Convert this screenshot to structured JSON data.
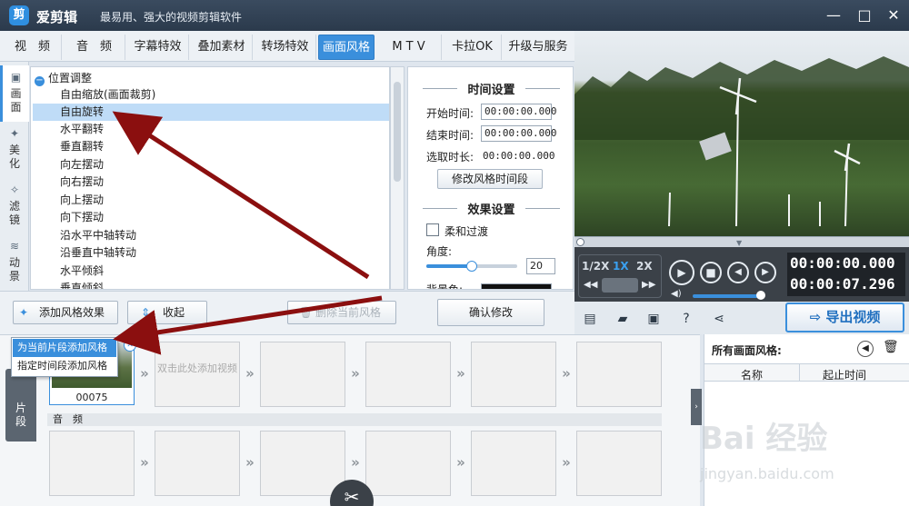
{
  "app": {
    "logo_glyph": "剪",
    "title": "爱剪辑",
    "slogan": "最易用、强大的视频剪辑软件",
    "win_minimize": "—",
    "win_maximize": "□",
    "win_close": "✕"
  },
  "tabs": [
    {
      "label": "视　频"
    },
    {
      "label": "音　频"
    },
    {
      "label": "字幕特效"
    },
    {
      "label": "叠加素材"
    },
    {
      "label": "转场特效"
    },
    {
      "label": "画面风格"
    },
    {
      "label": "M T V"
    },
    {
      "label": "卡拉OK"
    },
    {
      "label": "升级与服务"
    }
  ],
  "side_nav": [
    {
      "label": "画面",
      "icon": "picture-icon"
    },
    {
      "label": "美化",
      "icon": "wand-icon"
    },
    {
      "label": "滤镜",
      "icon": "filter-icon"
    },
    {
      "label": "动景",
      "icon": "wave-icon"
    }
  ],
  "style_list": {
    "group": "位置调整",
    "items": [
      "自由缩放(画面裁剪)",
      "自由旋转",
      "水平翻转",
      "垂直翻转",
      "向左摆动",
      "向右摆动",
      "向上摆动",
      "向下摆动",
      "沿水平中轴转动",
      "沿垂直中轴转动",
      "水平倾斜",
      "垂直倾斜"
    ],
    "selected": "自由旋转"
  },
  "settings": {
    "time_title": "时间设置",
    "start_label": "开始时间:",
    "start_value": "00:00:00.000",
    "end_label": "结束时间:",
    "end_value": "00:00:00.000",
    "duration_label": "选取时长:",
    "duration_value": "00:00:00.000",
    "modify_time_button": "修改风格时间段",
    "effect_title": "效果设置",
    "fade_label": "柔和过渡",
    "angle_label": "角度:",
    "angle_value": "20",
    "angle_slider_fraction": 0.5,
    "bg_label": "背景色:"
  },
  "actions": {
    "add_style": "添加风格效果",
    "collapse": "收起",
    "delete_style": "删除当前风格",
    "confirm": "确认修改"
  },
  "dropdown": {
    "items": [
      "为当前片段添加风格",
      "指定时间段添加风格"
    ],
    "highlighted": 0
  },
  "player": {
    "speed_half": "1/2X",
    "speed_1x": "1X",
    "speed_2x": "2X",
    "current_time": "00:00:00.000",
    "total_time": "00:00:07.296",
    "seek_fraction": 0.0
  },
  "toolbar": {
    "export_label": "导出视频"
  },
  "timeline": {
    "clip_tab_label": "片段",
    "clip_number": "00075",
    "add_hint": "双击此处添加视频",
    "audio_label": "音　频"
  },
  "right_panel": {
    "title": "所有画面风格:",
    "col_name": "名称",
    "col_start": "起止时间"
  },
  "watermark": {
    "brand": "Bai 经验",
    "url": "jingyan.baidu.com"
  },
  "colors": {
    "accent": "#3a8fdc",
    "titlebar": "#2b3a4c",
    "annotation_arrow": "#8b0f0f"
  }
}
